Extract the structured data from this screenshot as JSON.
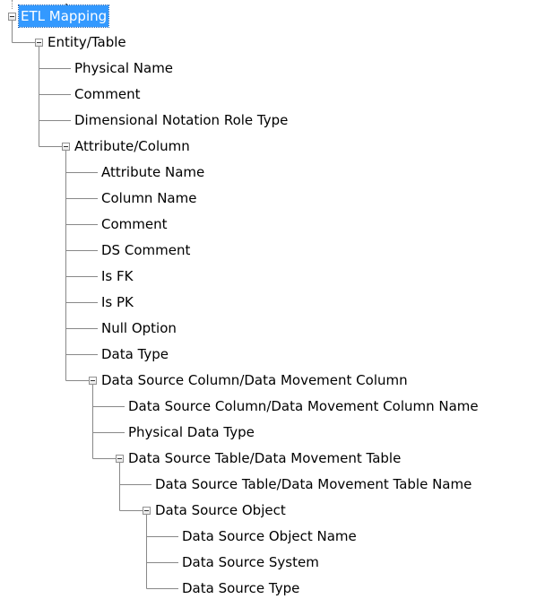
{
  "tree": {
    "label": "ETL Mapping",
    "expanded": true,
    "selected": true,
    "children": [
      {
        "label": "Entity/Table",
        "expanded": true,
        "children": [
          {
            "label": "Physical Name"
          },
          {
            "label": "Comment"
          },
          {
            "label": "Dimensional Notation Role Type"
          },
          {
            "label": "Attribute/Column",
            "expanded": true,
            "children": [
              {
                "label": "Attribute Name"
              },
              {
                "label": "Column Name"
              },
              {
                "label": "Comment"
              },
              {
                "label": "DS Comment"
              },
              {
                "label": "Is FK"
              },
              {
                "label": "Is PK"
              },
              {
                "label": "Null Option"
              },
              {
                "label": "Data Type"
              },
              {
                "label": "Data Source Column/Data Movement Column",
                "expanded": true,
                "children": [
                  {
                    "label": "Data Source Column/Data Movement Column Name"
                  },
                  {
                    "label": "Physical Data Type"
                  },
                  {
                    "label": "Data Source Table/Data Movement Table",
                    "expanded": true,
                    "children": [
                      {
                        "label": "Data Source Table/Data Movement Table Name"
                      },
                      {
                        "label": "Data Source Object",
                        "expanded": true,
                        "children": [
                          {
                            "label": "Data Source Object Name"
                          },
                          {
                            "label": "Data Source System"
                          },
                          {
                            "label": "Data Source Type"
                          }
                        ]
                      }
                    ]
                  }
                ]
              }
            ]
          }
        ]
      }
    ]
  },
  "colors": {
    "selection_bg": "#3399ff",
    "selection_text": "#ffffff",
    "connector": "#888888",
    "toggle_border": "#919191"
  },
  "icons": {
    "expanded": "minus-box-icon"
  }
}
